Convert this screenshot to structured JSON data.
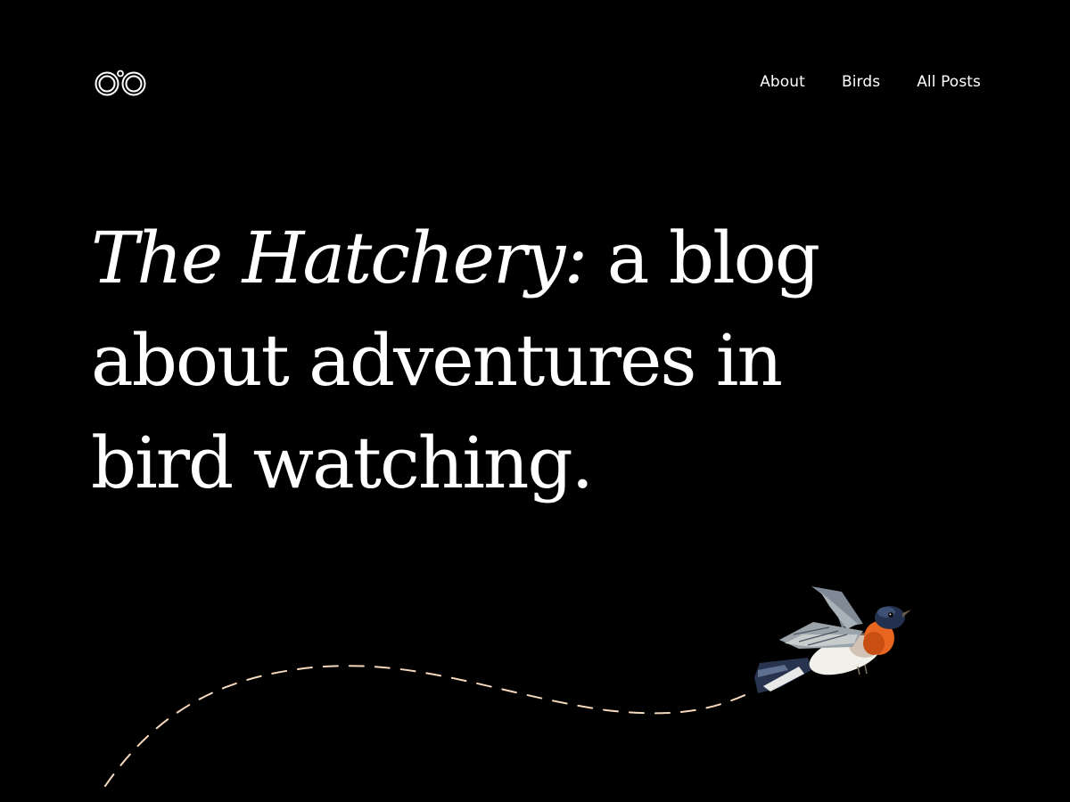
{
  "colors": {
    "background": "#000000",
    "text": "#ffffff",
    "flight_path": "#f6d8bd",
    "bird_orange": "#e8661f",
    "bird_blue": "#23314f"
  },
  "header": {
    "logo_icon": "binoculars-icon",
    "nav": [
      {
        "label": "About"
      },
      {
        "label": "Birds"
      },
      {
        "label": "All Posts"
      }
    ]
  },
  "hero": {
    "title_italic": "The Hatchery:",
    "title_rest": " a blog about adventures in bird watching."
  },
  "illustration": {
    "icon": "bird-illustration",
    "path_icon": "dashed-flight-path"
  }
}
